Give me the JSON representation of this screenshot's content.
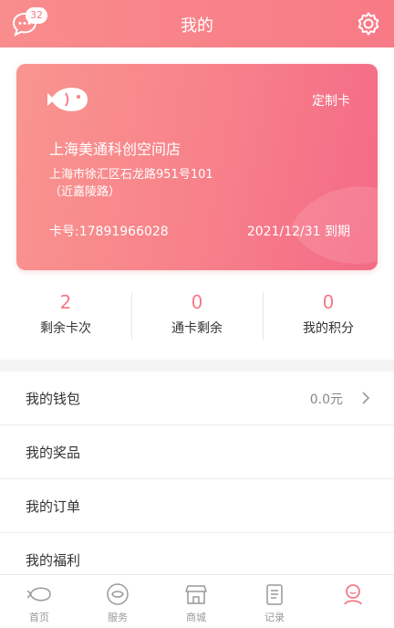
{
  "header": {
    "title": "我的",
    "message_badge": "32"
  },
  "card": {
    "type_label": "定制卡",
    "store_name": "上海美通科创空间店",
    "address": "上海市徐汇区石龙路951号101（近嘉陵路）",
    "card_number": "卡号:17891966028",
    "expiry": "2021/12/31 到期"
  },
  "stats": [
    {
      "value": "2",
      "label": "剩余卡次"
    },
    {
      "value": "0",
      "label": "通卡剩余"
    },
    {
      "value": "0",
      "label": "我的积分"
    }
  ],
  "menu": [
    {
      "label": "我的钱包",
      "value": "0.0元"
    },
    {
      "label": "我的奖品",
      "value": ""
    },
    {
      "label": "我的订单",
      "value": ""
    },
    {
      "label": "我的福利",
      "value": ""
    }
  ],
  "tabs": [
    {
      "label": "首页",
      "icon": "home-fish-icon"
    },
    {
      "label": "服务",
      "icon": "service-icon"
    },
    {
      "label": "商城",
      "icon": "store-icon"
    },
    {
      "label": "记录",
      "icon": "record-icon"
    },
    {
      "label": "",
      "icon": "profile-icon",
      "active": true
    }
  ],
  "colors": {
    "accent": "#f47a86",
    "header": "#f98c8c",
    "card_start": "#f9958f",
    "card_end": "#f46a86"
  }
}
